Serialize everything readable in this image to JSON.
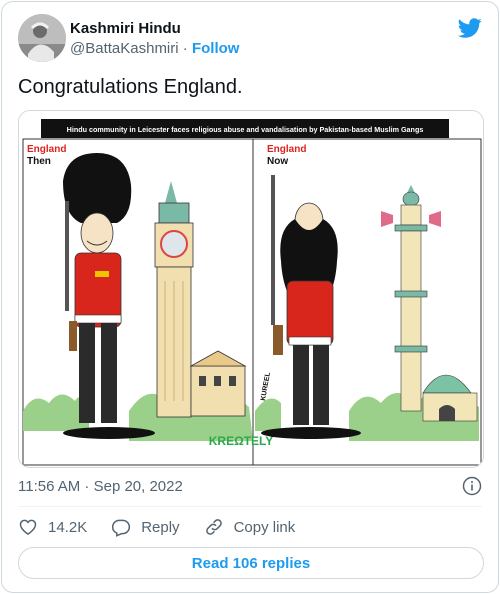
{
  "author": {
    "display_name": "Kashmiri Hindu",
    "handle": "@BattaKashmiri",
    "separator": "·",
    "follow_label": "Follow",
    "avatar_icon": "avatar-photo"
  },
  "tweet": {
    "text": "Congratulations England.",
    "timestamp": "11:56 AM · Sep 20, 2022"
  },
  "media": {
    "headline": "Hindu community in Leicester faces religious abuse and vandalisation by Pakistan-based Muslim Gangs",
    "left_panel": {
      "line1": "England",
      "line2": "Then"
    },
    "right_panel": {
      "line1": "England",
      "line2": "Now"
    },
    "artist_signature": "KUREEL",
    "watermark": "KREΩTELY"
  },
  "actions": {
    "like_count": "14.2K",
    "reply_label": "Reply",
    "copy_link_label": "Copy link"
  },
  "replies_button": "Read 106 replies",
  "colors": {
    "brand_blue": "#1d9bf0",
    "text_primary": "#0f1419",
    "text_secondary": "#536471",
    "border": "#cfd9de",
    "england_red": "#d8261c"
  }
}
